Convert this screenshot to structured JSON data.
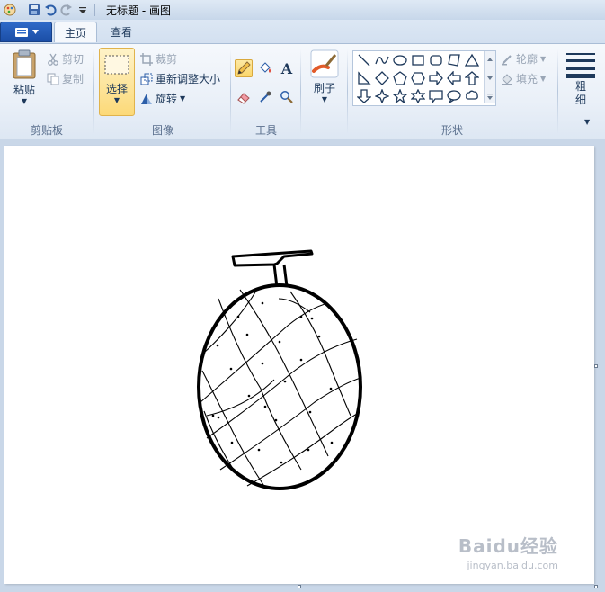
{
  "window": {
    "title": "无标题 - 画图"
  },
  "tabs": {
    "home": "主页",
    "view": "查看"
  },
  "ribbon": {
    "clipboard": {
      "label": "剪贴板",
      "paste": "粘贴",
      "cut": "剪切",
      "copy": "复制"
    },
    "image": {
      "label": "图像",
      "select": "选择",
      "crop": "裁剪",
      "resize": "重新调整大小",
      "rotate": "旋转"
    },
    "tools": {
      "label": "工具"
    },
    "brushes": {
      "label": "刷子"
    },
    "shapes": {
      "label": "形状",
      "outline": "轮廓",
      "fill": "填充"
    },
    "size": {
      "label": "粗\n细"
    }
  },
  "icons": [
    "app-menu-icon",
    "save-icon",
    "undo-icon",
    "redo-icon",
    "customize-qat-icon",
    "paste-icon",
    "cut-icon",
    "copy-icon",
    "select-icon",
    "crop-icon",
    "resize-icon",
    "rotate-icon",
    "pencil-icon",
    "fill-bucket-icon",
    "text-icon",
    "eraser-icon",
    "color-picker-icon",
    "magnifier-icon",
    "brush-icon",
    "line-icon",
    "curve-icon",
    "oval-icon",
    "rectangle-icon",
    "rounded-rectangle-icon",
    "polygon-icon",
    "triangle-icon",
    "right-triangle-icon",
    "diamond-icon",
    "pentagon-icon",
    "hexagon-icon",
    "arrow-right-icon",
    "arrow-left-icon",
    "arrow-up-icon",
    "arrow-down-icon",
    "star4-icon",
    "star5-icon",
    "star6-icon",
    "callout-rect-icon",
    "callout-oval-icon",
    "callout-cloud-icon",
    "outline-icon",
    "fill-icon",
    "size-icon"
  ],
  "watermark": {
    "main": "Baidu经验",
    "sub": "jingyan.baidu.com"
  },
  "colors": {
    "accent_file": "#2f6ac8",
    "select_active": "#fbd66a",
    "workspace": "#c9d7e8"
  }
}
